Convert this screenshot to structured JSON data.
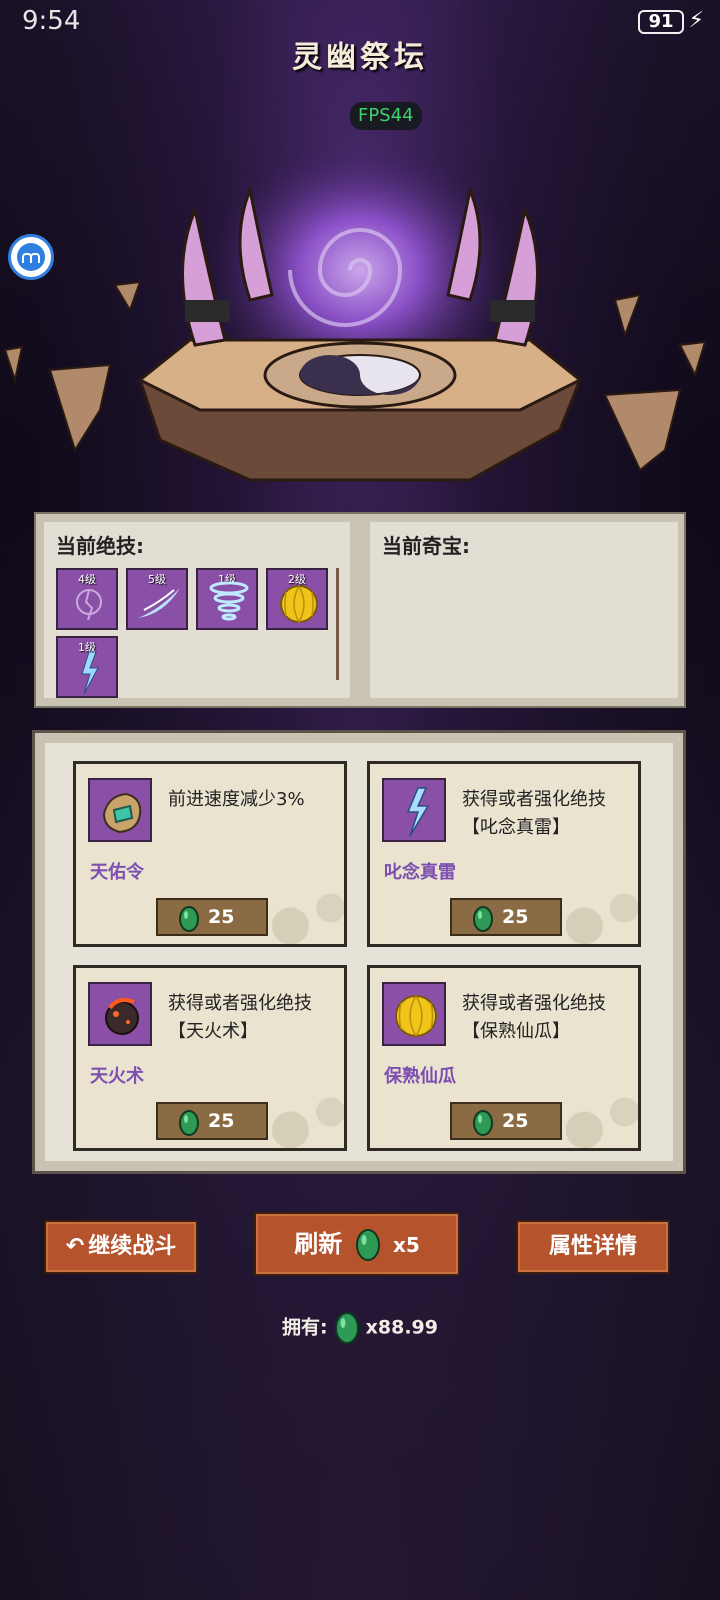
{
  "status_bar": {
    "time": "9:54",
    "battery": "91"
  },
  "title": "灵幽祭坛",
  "fps": "FPS44",
  "current_skills": {
    "label": "当前绝技:",
    "items": [
      {
        "level": "4级",
        "icon": "cracked-orb-icon"
      },
      {
        "level": "5级",
        "icon": "wind-blade-icon"
      },
      {
        "level": "1级",
        "icon": "tornado-icon"
      },
      {
        "level": "2级",
        "icon": "golden-melon-icon"
      },
      {
        "level": "1级",
        "icon": "lightning-icon"
      }
    ]
  },
  "current_treasures": {
    "label": "当前奇宝:"
  },
  "shop": {
    "cards": [
      {
        "name": "天佑令",
        "desc": "前进速度减少3%",
        "price": "25",
        "icon": "token-icon"
      },
      {
        "name": "叱念真雷",
        "desc": "获得或者强化绝技【叱念真雷】",
        "price": "25",
        "icon": "lightning-icon"
      },
      {
        "name": "天火术",
        "desc": "获得或者强化绝技【天火术】",
        "price": "25",
        "icon": "meteor-icon"
      },
      {
        "name": "保熟仙瓜",
        "desc": "获得或者强化绝技【保熟仙瓜】",
        "price": "25",
        "icon": "golden-melon-icon"
      }
    ]
  },
  "buttons": {
    "continue": "继续战斗",
    "refresh": "刷新",
    "refresh_cost": "x5",
    "attributes": "属性详情"
  },
  "owned": {
    "label": "拥有:",
    "amount": "x88.99"
  },
  "colors": {
    "accent_purple": "#8a4fa6",
    "button": "#b4532c",
    "gem": "#2f9a55",
    "fps": "#3ed06a"
  }
}
